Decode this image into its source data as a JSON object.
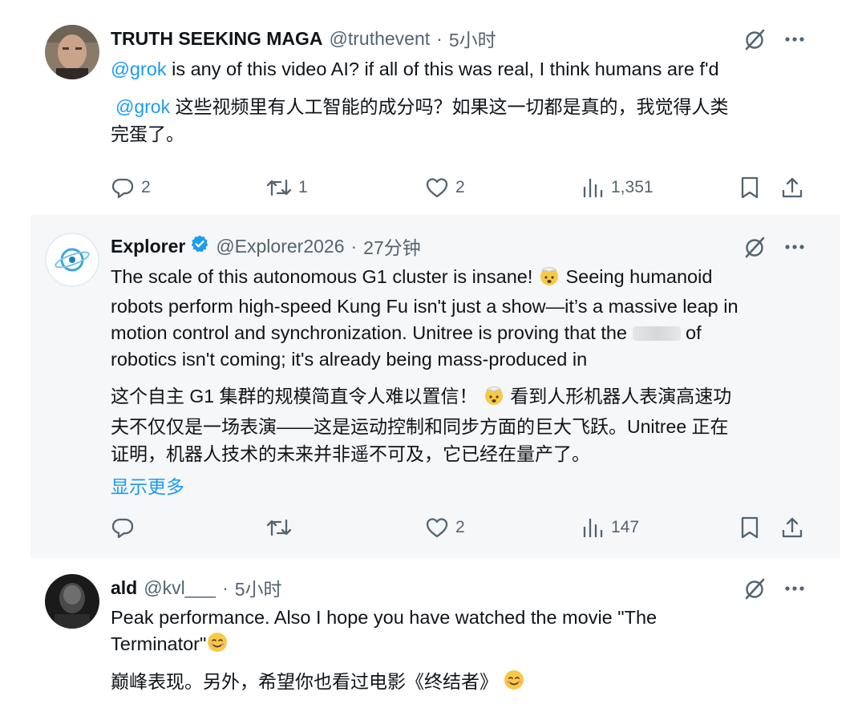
{
  "posts": [
    {
      "author": "TRUTH SEEKING MAGA",
      "handle": "@truthevent",
      "separator": "·",
      "time": "5小时",
      "text_mention": "@grok",
      "text_rest": " is any of this video AI? if all of this was real, I think humans are f'd",
      "trans_mention": "@grok",
      "trans_line1": " 这些视频里有人工智能的成分吗？如果这一切都是真的，我觉得人类",
      "trans_line2": "完蛋了。",
      "replies": "2",
      "reposts": "1",
      "likes": "2",
      "views": "1,351"
    },
    {
      "author": "Explorer",
      "verified": true,
      "handle": "@Explorer2026",
      "separator": "·",
      "time": "27分钟",
      "text_line1": "The scale of this autonomous G1 cluster is insane! ",
      "text_line1b": " Seeing humanoid",
      "text_line2": "robots perform high-speed Kung Fu isn't just a show—it’s a massive leap in",
      "text_line3a": "motion control and synchronization. Unitree is proving that the ",
      "text_line3b": " of",
      "text_line4": "robotics isn't coming; it's already being mass-produced in",
      "trans_line1a": "这个自主 G1 集群的规模简直令人难以置信！ ",
      "trans_line1b": " 看到人形机器人表演高速功",
      "trans_line2": "夫不仅仅是一场表演——这是运动控制和同步方面的巨大飞跃。Unitree 正在",
      "trans_line3": "证明，机器人技术的未来并非遥不可及，它已经在量产了。",
      "show_more": "显示更多",
      "replies": "",
      "reposts": "",
      "likes": "2",
      "views": "147"
    },
    {
      "author": "ald",
      "handle": "@kvl___",
      "separator": "·",
      "time": "5小时",
      "text_line1": "Peak performance. Also I hope you have watched the movie \"The",
      "text_line2": "Terminator\"",
      "trans_line1": "巅峰表现。另外，希望你也看过电影《终结者》 "
    }
  ],
  "icons": {
    "mute": "grok-slash-icon",
    "more": "more-icon",
    "reply": "reply-icon",
    "repost": "repost-icon",
    "like": "like-icon",
    "views": "views-icon",
    "bookmark": "bookmark-icon",
    "share": "share-icon",
    "verified": "verified-badge-icon",
    "emoji_mindblown": "exploding-head-emoji",
    "emoji_smile": "smiling-face-emoji"
  },
  "colors": {
    "text": "#0f1419",
    "secondary": "#536471",
    "link": "#1d9bf0",
    "highlight_bg": "#f6f7f8"
  }
}
